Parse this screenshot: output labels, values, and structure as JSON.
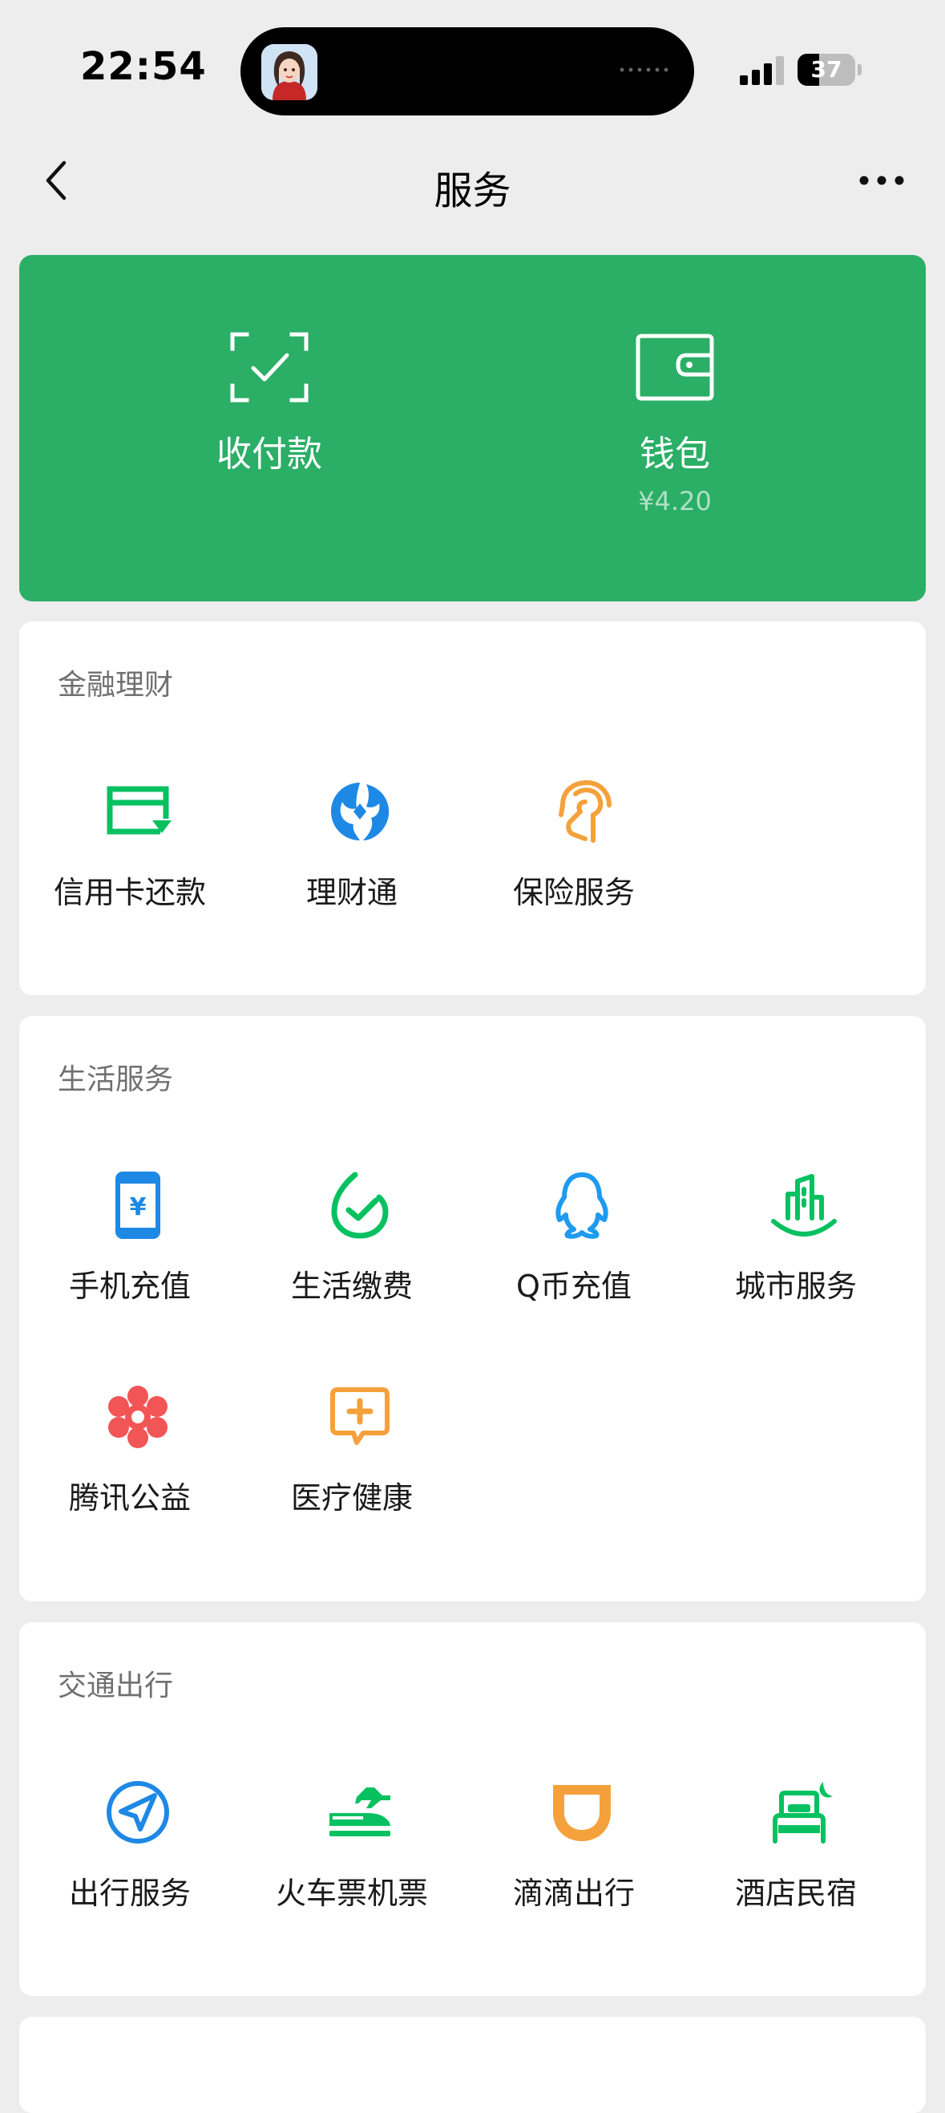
{
  "status_bar": {
    "time": "22:54",
    "battery": "37"
  },
  "nav": {
    "title": "服务"
  },
  "wallet_card": {
    "pay": {
      "label": "收付款"
    },
    "wallet": {
      "label": "钱包",
      "balance": "¥4.20"
    }
  },
  "sections": [
    {
      "title": "金融理财",
      "items": [
        {
          "label": "信用卡还款",
          "icon": "credit-card-icon"
        },
        {
          "label": "理财通",
          "icon": "wealth-icon"
        },
        {
          "label": "保险服务",
          "icon": "insurance-icon"
        }
      ]
    },
    {
      "title": "生活服务",
      "items": [
        {
          "label": "手机充值",
          "icon": "phone-topup-icon"
        },
        {
          "label": "生活缴费",
          "icon": "bills-icon"
        },
        {
          "label": "Q币充值",
          "icon": "qq-coin-icon"
        },
        {
          "label": "城市服务",
          "icon": "city-icon"
        },
        {
          "label": "腾讯公益",
          "icon": "charity-icon"
        },
        {
          "label": "医疗健康",
          "icon": "medical-icon"
        }
      ]
    },
    {
      "title": "交通出行",
      "items": [
        {
          "label": "出行服务",
          "icon": "navigation-icon"
        },
        {
          "label": "火车票机票",
          "icon": "train-plane-icon"
        },
        {
          "label": "滴滴出行",
          "icon": "didi-icon"
        },
        {
          "label": "酒店民宿",
          "icon": "hotel-icon"
        }
      ]
    }
  ],
  "colors": {
    "accent_green": "#2BAE66",
    "icon_green": "#07C160",
    "icon_blue": "#1E88E5",
    "icon_orange": "#F5A13B",
    "icon_red": "#F25555",
    "background": "#EDEDED"
  }
}
